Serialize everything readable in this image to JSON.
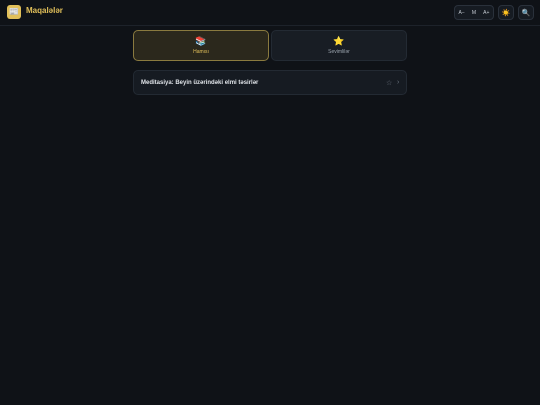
{
  "header": {
    "logo_glyph": "📰",
    "title": "Maqalələr",
    "font_controls": [
      "A−",
      "M",
      "A+"
    ],
    "theme_icon": "☀️",
    "search_icon": "🔍"
  },
  "tabs": [
    {
      "icon": "📚",
      "label": "Hamısı",
      "active": true
    },
    {
      "icon": "⭐",
      "label": "Sevimlilər",
      "active": false
    }
  ],
  "articles": [
    {
      "title": "Meditasiya: Beyin üzərindəki elmi təsirlər",
      "star_icon": "☆",
      "chevron_icon": "›"
    }
  ],
  "colors": {
    "background": "#0f1217",
    "accent": "#e2c05a",
    "card": "#161b22"
  }
}
